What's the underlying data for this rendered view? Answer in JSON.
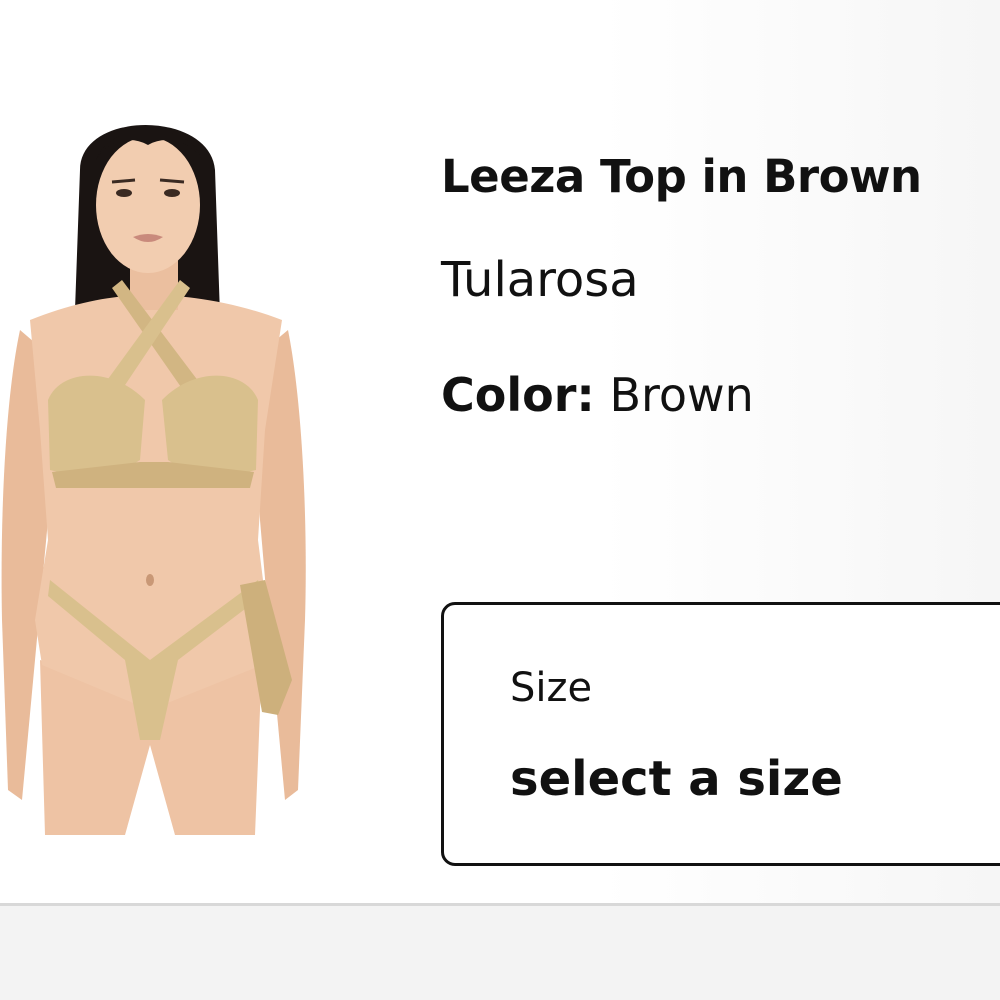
{
  "product": {
    "title": "Leeza Top in Brown",
    "brand": "Tularosa",
    "color_label": "Color:",
    "color_value": "Brown",
    "image_name": "product-photo"
  },
  "size_selector": {
    "label": "Size",
    "value": "select a size"
  },
  "colors": {
    "text": "#111111",
    "garment": "#d9c08d",
    "skin": "#eec3a4",
    "hair": "#1a1412"
  }
}
